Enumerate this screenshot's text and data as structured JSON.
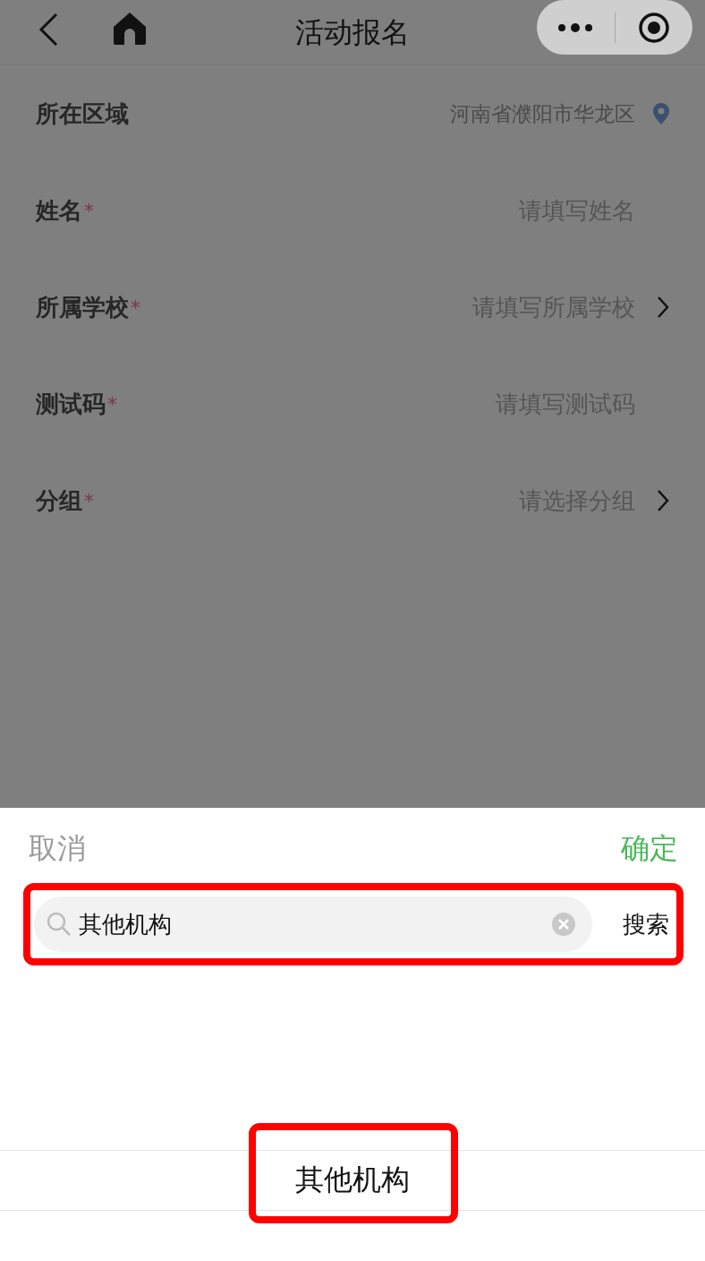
{
  "nav": {
    "title": "活动报名"
  },
  "form": [
    {
      "label": "所在区域",
      "kind": "location",
      "value": "河南省濮阳市华龙区"
    },
    {
      "label": "姓名",
      "required_mark": "*",
      "kind": "input",
      "placeholder": "请填写姓名"
    },
    {
      "label": "所属学校",
      "required_mark": "*",
      "kind": "picker",
      "placeholder": "请填写所属学校"
    },
    {
      "label": "测试码",
      "required_mark": "*",
      "kind": "input",
      "placeholder": "请填写测试码"
    },
    {
      "label": "分组",
      "required_mark": "*",
      "kind": "picker",
      "placeholder": "请选择分组"
    }
  ],
  "sheet": {
    "cancel": "取消",
    "confirm": "确定",
    "search": {
      "value": "其他机构",
      "button": "搜索",
      "highlighted": true
    },
    "options": [
      {
        "label": "其他机构",
        "highlighted": true
      }
    ]
  }
}
